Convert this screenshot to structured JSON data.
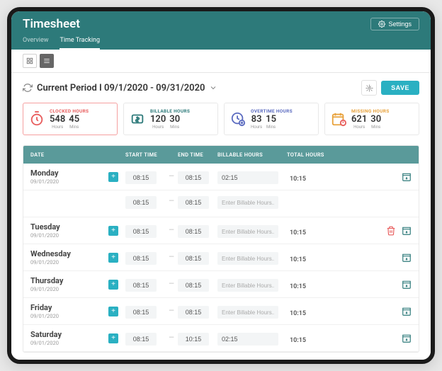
{
  "header": {
    "title": "Timesheet",
    "settings_label": "Settings",
    "tabs": [
      {
        "label": "Overview",
        "active": false
      },
      {
        "label": "Time Tracking",
        "active": true
      }
    ]
  },
  "period": {
    "title": "Current Period I 09/1/2020 - 09/31/2020",
    "save_label": "SAVE"
  },
  "stats": {
    "clocked": {
      "label": "CLOCKED HOURS",
      "hours": "548",
      "mins": "45"
    },
    "billable": {
      "label": "BILLABLE HOURS",
      "hours": "120",
      "mins": "30"
    },
    "overtime": {
      "label": "OVERTIME HOURS",
      "hours": "83",
      "mins": "15"
    },
    "missing": {
      "label": "MISSING HOURS",
      "hours": "621",
      "mins": "30"
    },
    "units": {
      "hours": "Hours",
      "mins": "Mins"
    }
  },
  "table": {
    "headers": {
      "date": "DATE",
      "start": "START TIME",
      "end": "END TIME",
      "billable": "BILLABLE HOURS",
      "total": "TOTAL HOURS"
    },
    "placeholder_billable": "Enter Billable Hours...",
    "rows": [
      {
        "day": "Monday",
        "date": "09/01/2020",
        "start": "08:15",
        "end": "08:15",
        "billable": "02:15",
        "total": "10:15",
        "delete": false,
        "sub": [
          {
            "start": "08:15",
            "end": "08:15",
            "billable": ""
          }
        ]
      },
      {
        "day": "Tuesday",
        "date": "09/01/2020",
        "start": "08:15",
        "end": "08:15",
        "billable": "",
        "total": "10:15",
        "delete": true
      },
      {
        "day": "Wednesday",
        "date": "09/01/2020",
        "start": "08:15",
        "end": "08:15",
        "billable": "",
        "total": "10:15",
        "delete": false
      },
      {
        "day": "Thursday",
        "date": "09/01/2020",
        "start": "08:15",
        "end": "08:15",
        "billable": "",
        "total": "10:15",
        "delete": false
      },
      {
        "day": "Friday",
        "date": "09/01/2020",
        "start": "08:15",
        "end": "08:15",
        "billable": "",
        "total": "10:15",
        "delete": false
      },
      {
        "day": "Saturday",
        "date": "09/01/2020",
        "start": "08:15",
        "end": "10:15",
        "billable": "02:15",
        "total": "10:15",
        "delete": false
      }
    ]
  },
  "colors": {
    "brand": "#2d7a7a",
    "accent": "#2ab0c2",
    "clocked": "#e85d5d",
    "billable": "#2d7a7a",
    "overtime": "#5b6bc0",
    "missing": "#e8a23c"
  }
}
